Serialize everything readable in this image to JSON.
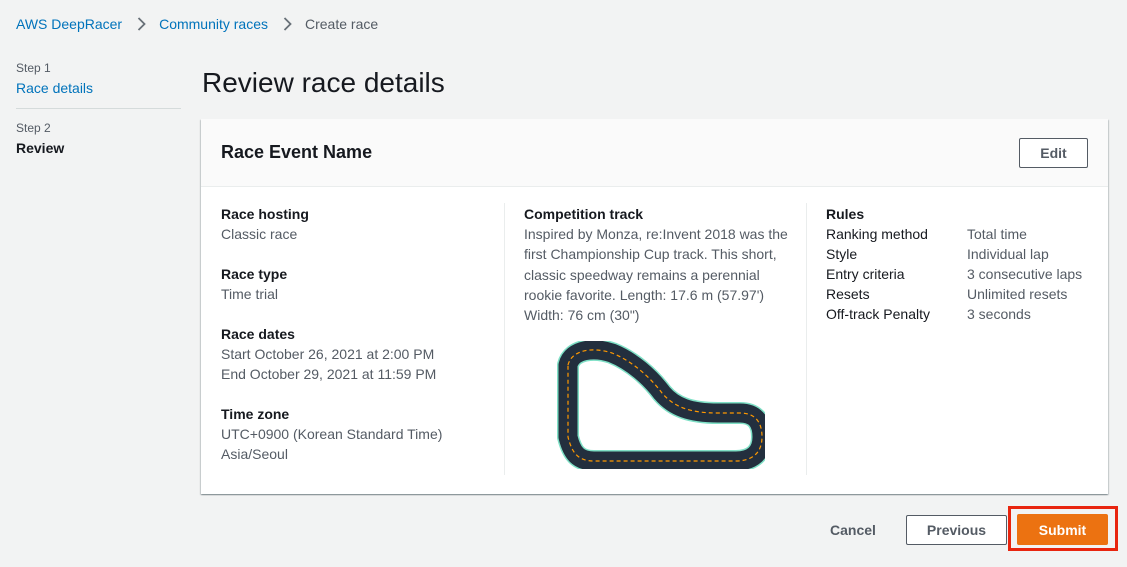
{
  "breadcrumb": {
    "items": [
      "AWS DeepRacer",
      "Community races"
    ],
    "current": "Create race"
  },
  "steps": [
    {
      "number": "Step 1",
      "title": "Race details"
    },
    {
      "number": "Step 2",
      "title": "Review"
    }
  ],
  "page_title": "Review race details",
  "card": {
    "title": "Race Event Name",
    "edit_label": "Edit",
    "race_hosting": {
      "label": "Race hosting",
      "value": "Classic race"
    },
    "race_type": {
      "label": "Race type",
      "value": "Time trial"
    },
    "race_dates": {
      "label": "Race dates",
      "start": "Start October 26, 2021 at 2:00 PM",
      "end": "End October 29, 2021 at 11:59 PM"
    },
    "time_zone": {
      "label": "Time zone",
      "offset": "UTC+0900 (Korean Standard Time)",
      "region": "Asia/Seoul"
    },
    "competition_track": {
      "label": "Competition track",
      "description": "Inspired by Monza, re:Invent 2018 was the first Championship Cup track. This short, classic speedway remains a perennial rookie favorite. Length: 17.6 m (57.97') Width: 76 cm (30\")"
    },
    "rules": {
      "label": "Rules",
      "rows": [
        {
          "key": "Ranking method",
          "value": "Total time"
        },
        {
          "key": "Style",
          "value": "Individual lap"
        },
        {
          "key": "Entry criteria",
          "value": "3 consecutive laps"
        },
        {
          "key": "Resets",
          "value": "Unlimited resets"
        },
        {
          "key": "Off-track Penalty",
          "value": "3 seconds"
        }
      ]
    }
  },
  "actions": {
    "cancel": "Cancel",
    "previous": "Previous",
    "submit": "Submit"
  },
  "colors": {
    "link": "#0073bb",
    "primary": "#ec7211",
    "highlight": "#e8250f",
    "track_asphalt": "#232f3e",
    "track_center_line": "#ff9900",
    "track_edge": "#7fe0c6"
  },
  "icons": [
    "chevron-right-icon",
    "track-map"
  ]
}
